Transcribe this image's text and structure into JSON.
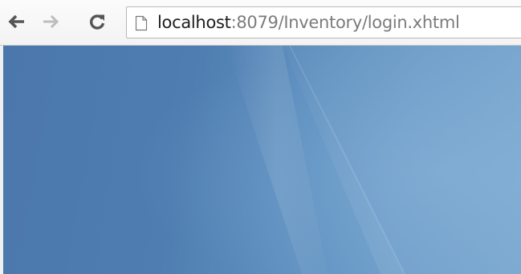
{
  "browser": {
    "nav": {
      "back_icon": "back-arrow-icon",
      "forward_icon": "forward-arrow-icon",
      "reload_icon": "reload-icon"
    },
    "address_bar": {
      "page_icon": "page-icon",
      "url_host": "localhost",
      "url_rest": ":8079/Inventory/login.xhtml"
    }
  },
  "colors": {
    "toolbar": "#f6f6f6",
    "viewport_dark": "#4b77ac",
    "viewport_light": "#77a6cf",
    "icon_active": "#555555",
    "icon_disabled": "#bdbdbd"
  }
}
